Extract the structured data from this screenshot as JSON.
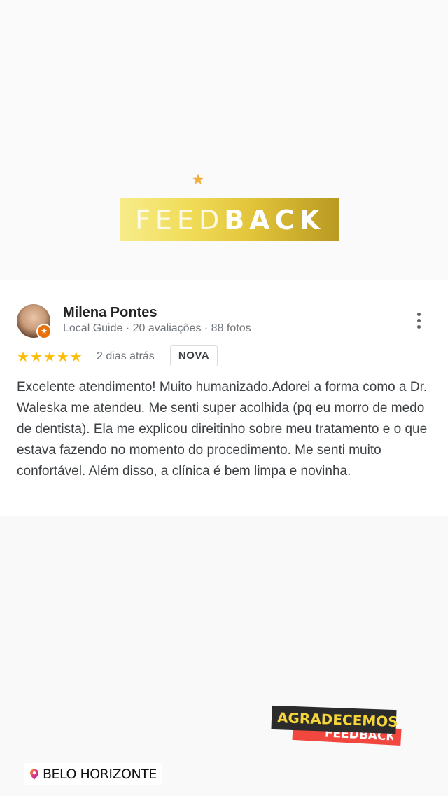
{
  "header": {
    "banner_light": "FEED",
    "banner_bold": "BACK",
    "star_color": "#f0b040",
    "banner_gradient": [
      "#f7ec8a",
      "#b99a22"
    ]
  },
  "review": {
    "reviewer_name": "Milena Pontes",
    "reviewer_meta": "Local Guide · 20 avaliações · 88 fotos",
    "rating": 5,
    "rating_max": 5,
    "star_glyph": "★",
    "time_ago": "2 dias atrás",
    "badge": "NOVA",
    "text": "Excelente atendimento! Muito humanizado.Adorei a forma como a Dr. Waleska me atendeu. Me senti super acolhida (pq eu morro de medo de dentista). Ela me explicou direitinho sobre meu tratamento e o que estava fazendo no momento do procedimento. Me senti muito confortável. Além disso, a clínica é bem limpa e novinha.",
    "star_color": "#fbbc04",
    "badge_icon": "local-guide-star-icon"
  },
  "stickers": {
    "agradecemos": "AGRADECEMOS",
    "agradecemos_under": "FEEDBACK",
    "location": "BELO HORIZONTE",
    "location_icon": "map-pin-icon"
  }
}
